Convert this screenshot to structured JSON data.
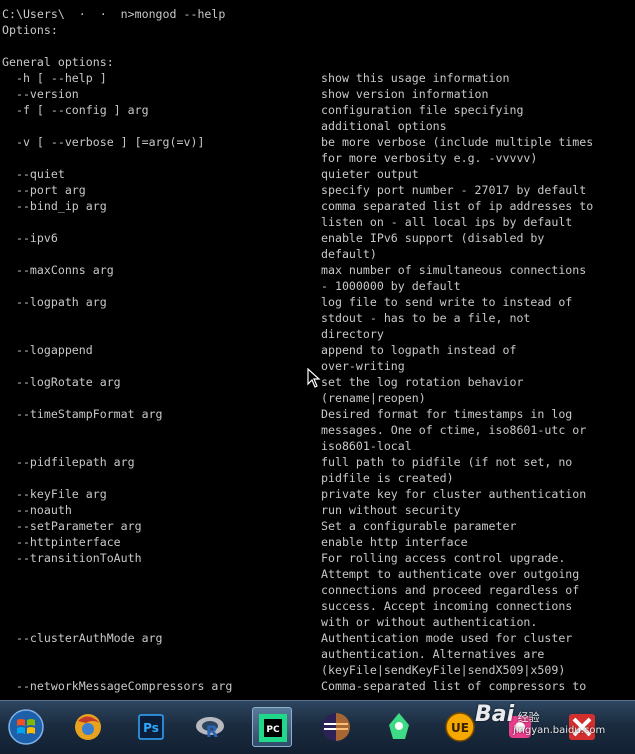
{
  "console": {
    "prompt_line": "C:\\Users\\  ·  ·  n>mongod --help",
    "options_heading": "Options:",
    "general_heading": "General options:",
    "options": [
      {
        "flag": "  -h [ --help ]",
        "desc": [
          "show this usage information"
        ]
      },
      {
        "flag": "  --version",
        "desc": [
          "show version information"
        ]
      },
      {
        "flag": "  -f [ --config ] arg",
        "desc": [
          "configuration file specifying",
          "additional options"
        ]
      },
      {
        "flag": "  -v [ --verbose ] [=arg(=v)]",
        "desc": [
          "be more verbose (include multiple times",
          "for more verbosity e.g. -vvvvv)"
        ]
      },
      {
        "flag": "  --quiet",
        "desc": [
          "quieter output"
        ]
      },
      {
        "flag": "  --port arg",
        "desc": [
          "specify port number - 27017 by default"
        ]
      },
      {
        "flag": "  --bind_ip arg",
        "desc": [
          "comma separated list of ip addresses to",
          "listen on - all local ips by default"
        ]
      },
      {
        "flag": "  --ipv6",
        "desc": [
          "enable IPv6 support (disabled by",
          "default)"
        ]
      },
      {
        "flag": "  --maxConns arg",
        "desc": [
          "max number of simultaneous connections",
          "- 1000000 by default"
        ]
      },
      {
        "flag": "  --logpath arg",
        "desc": [
          "log file to send write to instead of",
          "stdout - has to be a file, not",
          "directory"
        ]
      },
      {
        "flag": "  --logappend",
        "desc": [
          "append to logpath instead of",
          "over-writing"
        ]
      },
      {
        "flag": "  --logRotate arg",
        "desc": [
          "set the log rotation behavior",
          "(rename|reopen)"
        ]
      },
      {
        "flag": "  --timeStampFormat arg",
        "desc": [
          "Desired format for timestamps in log",
          "messages. One of ctime, iso8601-utc or",
          "iso8601-local"
        ]
      },
      {
        "flag": "  --pidfilepath arg",
        "desc": [
          "full path to pidfile (if not set, no",
          "pidfile is created)"
        ]
      },
      {
        "flag": "  --keyFile arg",
        "desc": [
          "private key for cluster authentication"
        ]
      },
      {
        "flag": "  --noauth",
        "desc": [
          "run without security"
        ]
      },
      {
        "flag": "  --setParameter arg",
        "desc": [
          "Set a configurable parameter"
        ]
      },
      {
        "flag": "  --httpinterface",
        "desc": [
          "enable http interface"
        ]
      },
      {
        "flag": "  --transitionToAuth",
        "desc": [
          "For rolling access control upgrade.",
          "Attempt to authenticate over outgoing",
          "connections and proceed regardless of",
          "success. Accept incoming connections",
          "with or without authentication."
        ]
      },
      {
        "flag": "  --clusterAuthMode arg",
        "desc": [
          "Authentication mode used for cluster",
          "authentication. Alternatives are",
          "(keyFile|sendKeyFile|sendX509|x509)"
        ]
      },
      {
        "flag": "  --networkMessageCompressors arg",
        "desc": [
          "Comma-separated list of compressors to"
        ]
      }
    ]
  },
  "taskbar": {
    "items": [
      {
        "name": "start-button",
        "label": ""
      },
      {
        "name": "browser-app",
        "label": ""
      },
      {
        "name": "photoshop-app",
        "label": "Ps"
      },
      {
        "name": "r-app",
        "label": "R"
      },
      {
        "name": "pycharm-app",
        "label": "PC"
      },
      {
        "name": "eclipse-app",
        "label": ""
      },
      {
        "name": "android-app",
        "label": ""
      },
      {
        "name": "ultraedit-app",
        "label": "UE"
      },
      {
        "name": "media-app",
        "label": ""
      },
      {
        "name": "xmind-app",
        "label": ""
      }
    ]
  },
  "watermark": {
    "brand": "Bai",
    "brand_cn": "经验",
    "url": "jingyan.baidu.com"
  },
  "colors": {
    "console_bg": "#000000",
    "console_text": "#c8c8c8"
  }
}
